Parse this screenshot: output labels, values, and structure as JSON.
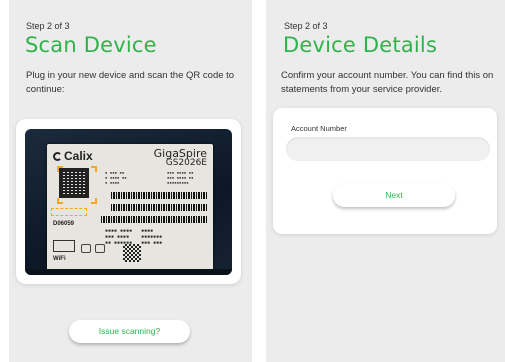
{
  "scan_screen": {
    "step": "Step 2 of 3",
    "title": "Scan Device",
    "description": "Plug in your new device and scan the QR code to continue:",
    "photo": {
      "brand": "Calix",
      "model_brand": "GigaSpire",
      "model_number": "GS2026E",
      "serial_text": "D06059",
      "wifi_mark": "WiFi"
    },
    "issue_button": "Issue scanning?"
  },
  "details_screen": {
    "step": "Step 2 of 3",
    "title": "Device Details",
    "description": "Confirm your account number. You can find this on statements from your service provider.",
    "account_label": "Account Number",
    "account_value": "",
    "next_button": "Next"
  },
  "colors": {
    "accent_green": "#2fb34a",
    "panel_gray": "#ececec",
    "scan_highlight": "#f5a623"
  }
}
